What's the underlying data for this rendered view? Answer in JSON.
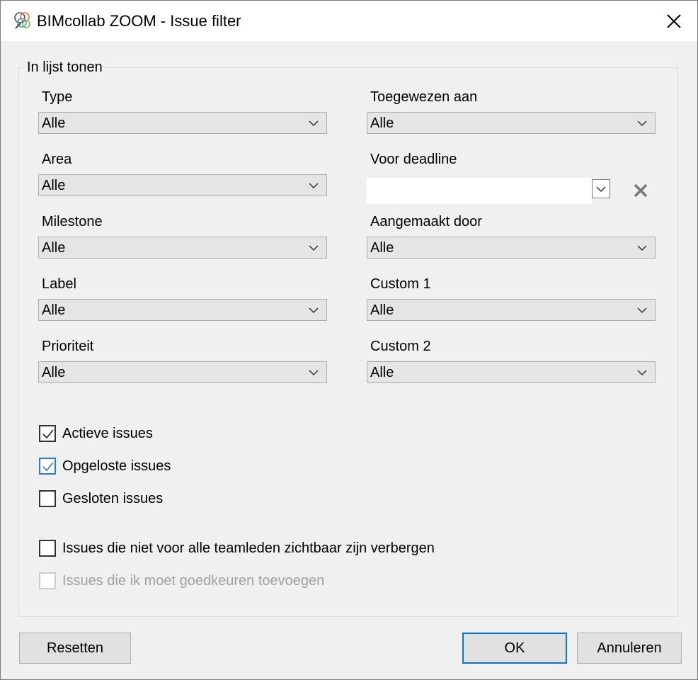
{
  "window": {
    "title": "BIMcollab ZOOM - Issue filter"
  },
  "group": {
    "title": "In lijst tonen"
  },
  "fields": {
    "type": {
      "label": "Type",
      "value": "Alle"
    },
    "area": {
      "label": "Area",
      "value": "Alle"
    },
    "milestone": {
      "label": "Milestone",
      "value": "Alle"
    },
    "label": {
      "label": "Label",
      "value": "Alle"
    },
    "prioriteit": {
      "label": "Prioriteit",
      "value": "Alle"
    },
    "toegewezen": {
      "label": "Toegewezen aan",
      "value": "Alle"
    },
    "deadline": {
      "label": "Voor deadline",
      "value": ""
    },
    "aangemaakt": {
      "label": "Aangemaakt door",
      "value": "Alle"
    },
    "custom1": {
      "label": "Custom 1",
      "value": "Alle"
    },
    "custom2": {
      "label": "Custom 2",
      "value": "Alle"
    }
  },
  "checkboxes": {
    "actieve": {
      "label": "Actieve issues",
      "checked": true
    },
    "opgeloste": {
      "label": "Opgeloste issues",
      "checked": true
    },
    "gesloten": {
      "label": "Gesloten issues",
      "checked": false
    },
    "verbergen": {
      "label": "Issues die niet voor alle teamleden zichtbaar zijn verbergen",
      "checked": false
    },
    "goedkeuren": {
      "label": "Issues die ik moet goedkeuren toevoegen",
      "checked": false,
      "disabled": true
    }
  },
  "buttons": {
    "reset": "Resetten",
    "ok": "OK",
    "cancel": "Annuleren"
  },
  "colors": {
    "accent": "#0078d7",
    "check_blue": "#2b79d8",
    "disabled_text": "#a0a0a0"
  }
}
